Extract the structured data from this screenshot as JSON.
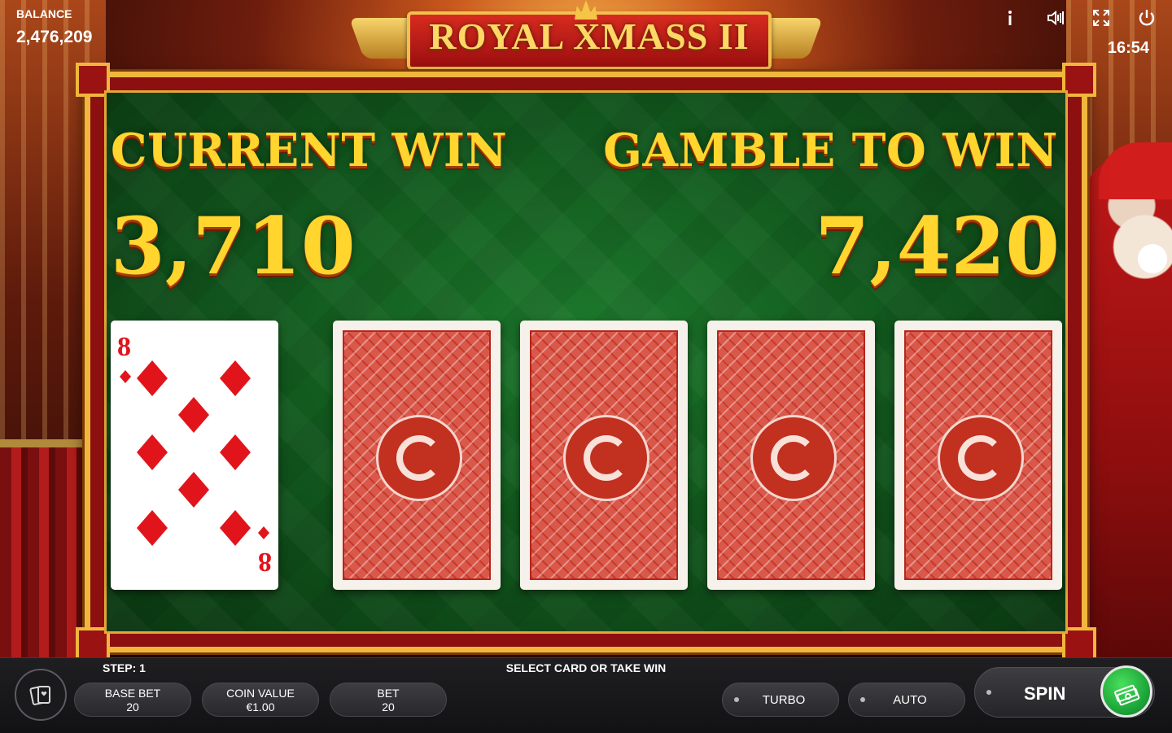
{
  "header": {
    "balance_label": "BALANCE",
    "balance_value": "2,476,209",
    "clock": "16:54",
    "game_title": "ROYAL XMASS II",
    "icons": [
      "info-icon",
      "sound-icon",
      "fullscreen-icon",
      "power-icon"
    ]
  },
  "gamble": {
    "current_win_label": "CURRENT WIN",
    "current_win_value": "3,710",
    "gamble_label": "GAMBLE TO WIN",
    "gamble_value": "7,420",
    "dealer_card": {
      "rank": "8",
      "suit": "diamonds"
    },
    "face_down_cards": 4
  },
  "bottom_bar": {
    "step_label": "STEP: 1",
    "message": "SELECT CARD OR TAKE WIN",
    "base_bet_label": "BASE BET",
    "base_bet_value": "20",
    "coin_value_label": "COIN VALUE",
    "coin_value_value": "€1.00",
    "bet_label": "BET",
    "bet_value": "20",
    "turbo_label": "TURBO",
    "auto_label": "AUTO",
    "spin_label": "SPIN"
  },
  "colors": {
    "gold": "#ffd52e",
    "felt_green": "#1d7a2c",
    "frame_gold": "#f0b73c",
    "card_red": "#e2141b",
    "spin_green": "#1ea83a"
  }
}
